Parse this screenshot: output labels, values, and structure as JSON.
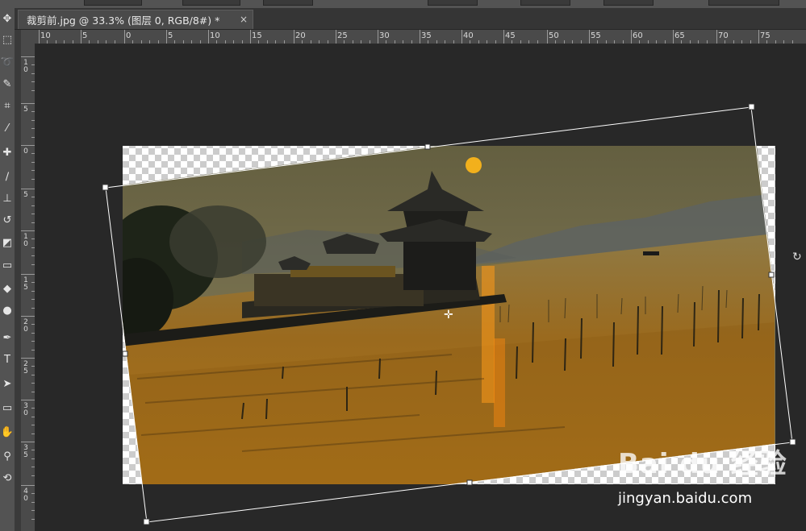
{
  "document_tab": {
    "title": "裁剪前.jpg @ 33.3% (图层 0, RGB/8#) *",
    "close_symbol": "×"
  },
  "ruler": {
    "horizontal_labels": [
      "10",
      "5",
      "0",
      "5",
      "10",
      "15",
      "20",
      "25",
      "30",
      "35",
      "40",
      "45",
      "50",
      "55",
      "60",
      "65",
      "70",
      "75"
    ],
    "vertical_labels": [
      "1\n0",
      "5",
      "0",
      "5",
      "1\n0",
      "1\n5",
      "2\n0",
      "2\n5",
      "3\n0",
      "3\n5",
      "4\n0"
    ]
  },
  "tools": [
    {
      "name": "move-tool-icon",
      "glyph": "✥"
    },
    {
      "name": "marquee-tool-icon",
      "glyph": "⬚"
    },
    {
      "name": "lasso-tool-icon",
      "glyph": "➰"
    },
    {
      "name": "quick-select-tool-icon",
      "glyph": "✎"
    },
    {
      "name": "crop-tool-icon",
      "glyph": "⌗"
    },
    {
      "name": "eyedropper-tool-icon",
      "glyph": "⁄"
    },
    {
      "name": "healing-brush-tool-icon",
      "glyph": "✚"
    },
    {
      "name": "brush-tool-icon",
      "glyph": "∕"
    },
    {
      "name": "clone-stamp-tool-icon",
      "glyph": "⊥"
    },
    {
      "name": "history-brush-tool-icon",
      "glyph": "↺"
    },
    {
      "name": "eraser-tool-icon",
      "glyph": "◩"
    },
    {
      "name": "gradient-tool-icon",
      "glyph": "▭"
    },
    {
      "name": "blur-tool-icon",
      "glyph": "◆"
    },
    {
      "name": "dodge-tool-icon",
      "glyph": "●"
    },
    {
      "name": "pen-tool-icon",
      "glyph": "✒"
    },
    {
      "name": "type-tool-icon",
      "glyph": "T"
    },
    {
      "name": "path-select-tool-icon",
      "glyph": "➤"
    },
    {
      "name": "shape-tool-icon",
      "glyph": "▭"
    },
    {
      "name": "hand-tool-icon",
      "glyph": "✋"
    },
    {
      "name": "zoom-tool-icon",
      "glyph": "⚲"
    },
    {
      "name": "rotate-view-tool-icon",
      "glyph": "⟲"
    }
  ],
  "transform": {
    "rotate_cursor_symbol": "↻",
    "center_marker_symbol": "✛"
  },
  "watermark": {
    "logo_text": "Bai du 经验",
    "url_text": "jingyan.baidu.com"
  },
  "colors": {
    "ui_background": "#282828",
    "panel": "#535353",
    "ruler": "#4a4a4a",
    "sky": "#6b6748",
    "water": "#b07a22",
    "sun": "#f2b01c"
  }
}
